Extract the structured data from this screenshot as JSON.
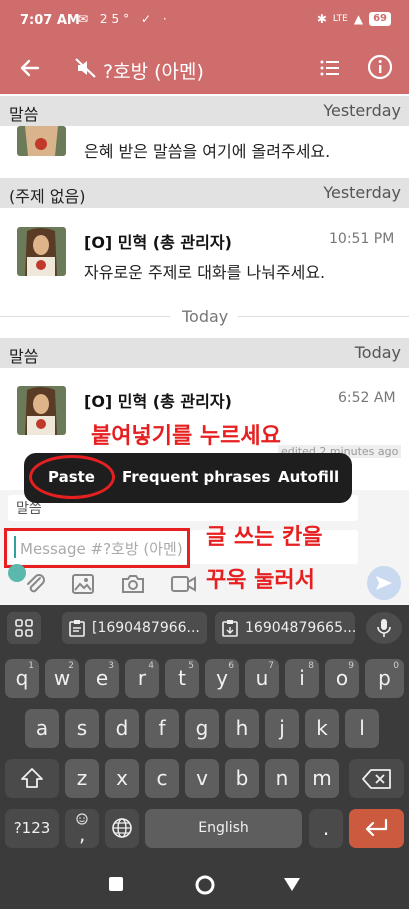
{
  "status_bar": {
    "time": "7:07 AM",
    "left_icons": "✉ 25° ✓ ·",
    "signal_label": "LTE",
    "battery": "69"
  },
  "app_bar": {
    "title": "?호방 (아멘)"
  },
  "sections": [
    {
      "channel": "말씀",
      "date": "Yesterday",
      "message_body": "은혜 받은 말씀을 여기에 올려주세요."
    },
    {
      "channel": "(주제 없음)",
      "date": "Yesterday",
      "sender": "[O] 민혁 (총 관리자)",
      "time": "10:51 PM",
      "message_body": "자유로운 주제로 대화를 나눠주세요."
    },
    {
      "channel": "말씀",
      "date": "Today",
      "sender": "[O] 민혁 (총 관리자)",
      "time": "6:52 AM",
      "edited_label": "edited 2 minutes ago"
    }
  ],
  "today_separator": "Today",
  "annotations": {
    "paste_instruction": "붙여넣기를 누르세요",
    "field_instruction_line1": "글 쓰는 칸을",
    "field_instruction_line2": "꾸욱 눌러서"
  },
  "popup_menu": {
    "items": [
      "Paste",
      "Frequent phrases",
      "Autofill"
    ]
  },
  "compose": {
    "topic_label": "말씀",
    "placeholder": "Message #?호방 (아멘)"
  },
  "keyboard": {
    "suggestions": [
      "[1690487966...",
      "16904879665..."
    ],
    "row1": [
      "q",
      "w",
      "e",
      "r",
      "t",
      "y",
      "u",
      "i",
      "o",
      "p"
    ],
    "row1_hints": [
      "1",
      "2",
      "3",
      "4",
      "5",
      "6",
      "7",
      "8",
      "9",
      "0"
    ],
    "row2": [
      "a",
      "s",
      "d",
      "f",
      "g",
      "h",
      "j",
      "k",
      "l"
    ],
    "row3": [
      "z",
      "x",
      "c",
      "v",
      "b",
      "n",
      "m"
    ],
    "symbols_key": "?123",
    "comma_key": ",",
    "space_label": "English",
    "period_key": "."
  },
  "colors": {
    "app_bar": "#cf6d6d",
    "annotation_red": "#e62020",
    "enter_key": "#cc5a3f"
  }
}
